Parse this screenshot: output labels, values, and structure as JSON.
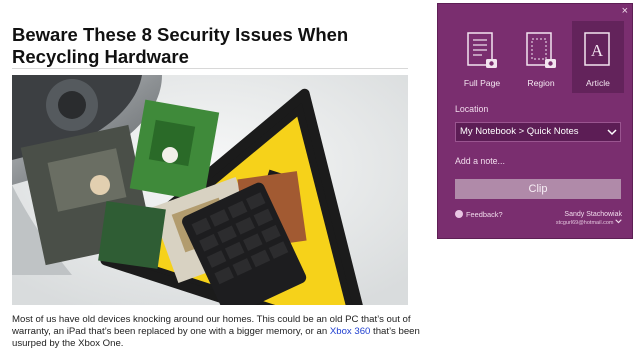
{
  "article": {
    "title": "Beware These 8 Security Issues When Recycling Hardware",
    "paragraph_start": "Most of us have old devices knocking around our homes. This could be an old PC that’s out of warranty, an iPad that’s been replaced by one with a bigger memory, or an ",
    "link_text": "Xbox 360",
    "paragraph_end": " that’s been usurped by the Xbox One."
  },
  "clipper": {
    "close_label": "×",
    "modes": [
      {
        "label": "Full Page",
        "icon": "full-page-icon",
        "selected": false
      },
      {
        "label": "Region",
        "icon": "region-icon",
        "selected": false
      },
      {
        "label": "Article",
        "icon": "article-icon",
        "selected": true
      }
    ],
    "location_label": "Location",
    "location_value": "My Notebook > Quick Notes",
    "note_placeholder": "Add a note...",
    "clip_label": "Clip",
    "feedback_label": "Feedback?",
    "user_name": "Sandy Stachowiak",
    "user_email": "stcgurl69@hotmail.com"
  },
  "colors": {
    "panel": "#7a2e6f",
    "panel_selected": "#63235b",
    "clip_button": "#b08aa9",
    "link": "#1f3fd0",
    "warning_yellow": "#f6d21a"
  }
}
